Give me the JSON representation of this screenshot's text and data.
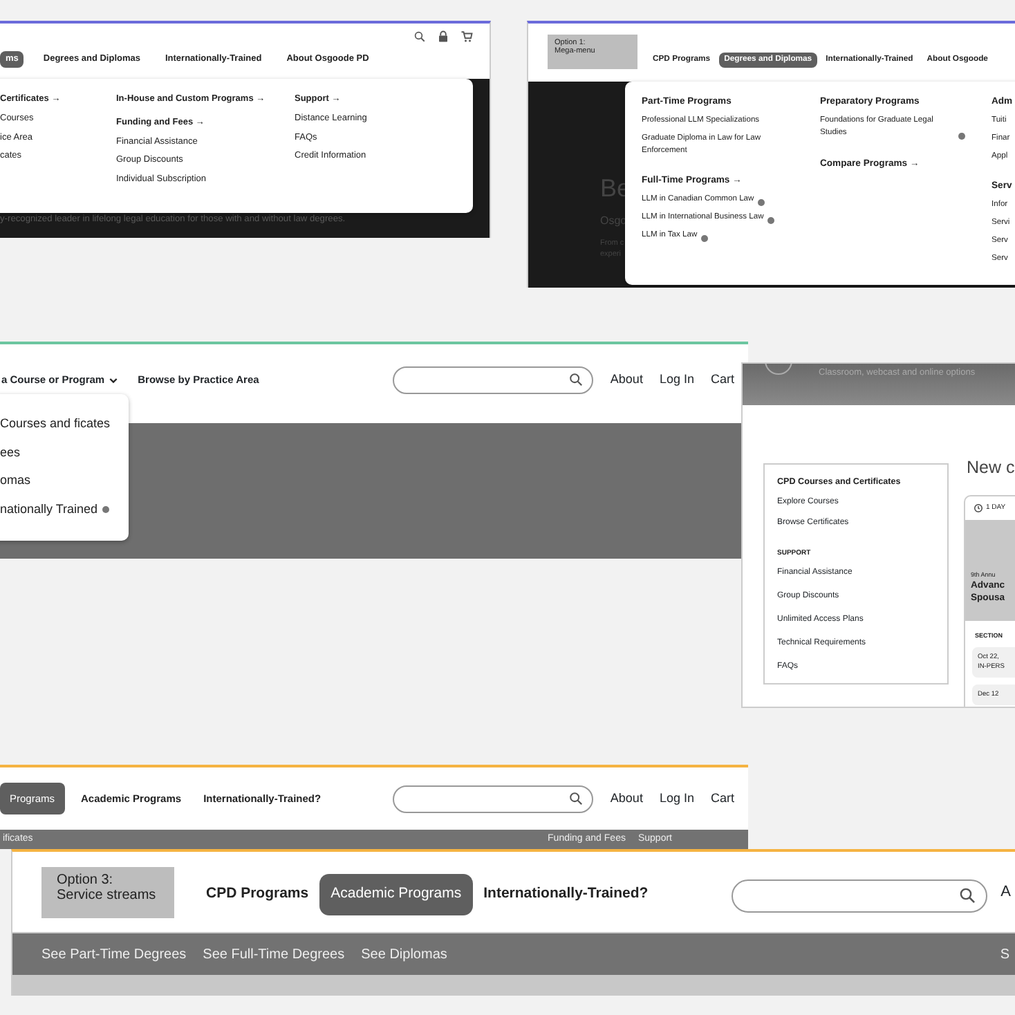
{
  "option_header_icons": {
    "nav": [
      {
        "label": "ms",
        "selected": true
      },
      {
        "label": "Degrees and Diplomas",
        "selected": false
      },
      {
        "label": "Internationally-Trained",
        "selected": false
      },
      {
        "label": "About Osgoode PD",
        "selected": false
      }
    ],
    "dropdown_columns": [
      [
        {
          "text": "Certificates →",
          "heading": true
        },
        {
          "text": "Courses",
          "heading": false
        },
        {
          "text": "ice Area",
          "heading": false
        },
        {
          "text": "cates",
          "heading": false
        }
      ],
      [
        {
          "text": "In-House and Custom Programs →",
          "heading": true
        },
        {
          "text": "Funding and Fees →",
          "heading": true
        },
        {
          "text": "Financial Assistance",
          "heading": false
        },
        {
          "text": "Group Discounts",
          "heading": false
        },
        {
          "text": "Individual Subscription",
          "heading": false
        }
      ],
      [
        {
          "text": "Support →",
          "heading": true
        },
        {
          "text": "Distance Learning",
          "heading": false
        },
        {
          "text": "FAQs",
          "heading": false
        },
        {
          "text": "Credit Information",
          "heading": false
        }
      ]
    ],
    "hero_text": "y-recognized leader in lifelong legal education for those with and without law degrees."
  },
  "option_1": {
    "label": "Option 1:\nMega-menu",
    "nav": [
      {
        "label": "CPD Programs",
        "selected": false
      },
      {
        "label": "Degrees and Diplomas",
        "selected": true
      },
      {
        "label": "Internationally-Trained",
        "selected": false
      },
      {
        "label": "About Osgoode",
        "selected": false
      }
    ],
    "hero": {
      "title": "Be",
      "subtitle": "Osgo",
      "body_lines": [
        "From c",
        "experi"
      ]
    },
    "mega_menu_columns": [
      [
        {
          "text": "Part-Time Programs",
          "heading": true,
          "info_icon": false
        },
        {
          "text": "Professional LLM Specializations",
          "heading": false,
          "info_icon": false
        },
        {
          "text": "Graduate Diploma in Law for Law Enforcement",
          "heading": false,
          "info_icon": false
        },
        {
          "text": "Full-Time Programs →",
          "heading": true,
          "info_icon": false
        },
        {
          "text": "LLM in Canadian Common Law",
          "heading": false,
          "info_icon": true
        },
        {
          "text": "LLM in International Business Law",
          "heading": false,
          "info_icon": true
        },
        {
          "text": "LLM in Tax Law",
          "heading": false,
          "info_icon": true
        }
      ],
      [
        {
          "text": "Preparatory Programs",
          "heading": true,
          "info_icon": false
        },
        {
          "text": "Foundations for Graduate Legal Studies",
          "heading": false,
          "info_icon": true
        },
        {
          "text": "Compare Programs →",
          "heading": true,
          "info_icon": false
        }
      ],
      [
        {
          "text": "Adm",
          "heading": true,
          "info_icon": false
        },
        {
          "text": "Tuiti",
          "heading": false,
          "info_icon": false
        },
        {
          "text": "Finar",
          "heading": false,
          "info_icon": false
        },
        {
          "text": "Appl",
          "heading": false,
          "info_icon": false
        },
        {
          "text": "Serv",
          "heading": true,
          "info_icon": false
        },
        {
          "text": "Infor",
          "heading": false,
          "info_icon": false
        },
        {
          "text": "Servi",
          "heading": false,
          "info_icon": false
        },
        {
          "text": "Serv",
          "heading": false,
          "info_icon": false
        },
        {
          "text": "Serv",
          "heading": false,
          "info_icon": false
        }
      ]
    ]
  },
  "option_dropdown": {
    "nav": [
      "a Course or Program",
      "Browse by Practice Area"
    ],
    "utility_links": [
      "About",
      "Log In",
      "Cart"
    ],
    "dropdown_items": [
      {
        "text": "Courses and ficates",
        "info_icon": false
      },
      {
        "text": "ees",
        "info_icon": false
      },
      {
        "text": "omas",
        "info_icon": false
      },
      {
        "text": "nationally Trained",
        "info_icon": true
      }
    ]
  },
  "landing_page": {
    "banner_text": "Classroom, webcast and online options",
    "heading": "New c",
    "sidebar": {
      "title": "CPD Courses and Certificates",
      "links": [
        "Explore Courses",
        "Browse Certificates"
      ],
      "section_title": "SUPPORT",
      "support_links": [
        "Financial Assistance",
        "Group Discounts",
        "Unlimited Access Plans",
        "Technical Requirements",
        "FAQs"
      ]
    },
    "course_card": {
      "duration": "1 DAY",
      "eyebrow": "9th Annu",
      "title_lines": [
        "Advanc",
        "Spousa"
      ],
      "section_label": "SECTION",
      "sessions": [
        {
          "date": "Oct 22,",
          "format": "IN-PERS"
        },
        {
          "date": "Dec 12"
        }
      ]
    }
  },
  "option_streams_compact": {
    "nav": [
      {
        "label": "Programs",
        "selected": true
      },
      {
        "label": "Academic Programs",
        "selected": false
      },
      {
        "label": "Internationally-Trained?",
        "selected": false
      }
    ],
    "utility_links": [
      "About",
      "Log In",
      "Cart"
    ],
    "subnav_left": [
      "ificates"
    ],
    "subnav_right": [
      "Funding and Fees",
      "Support"
    ]
  },
  "option_3": {
    "label": "Option 3:\nService streams",
    "nav": [
      {
        "label": "CPD Programs",
        "selected": false
      },
      {
        "label": "Academic Programs",
        "selected": true
      },
      {
        "label": "Internationally-Trained?",
        "selected": false
      }
    ],
    "utility_links": [
      "A"
    ],
    "subnav_left": [
      "See Part-Time Degrees",
      "See Full-Time Degrees",
      "See Diplomas"
    ],
    "subnav_right": [
      "S"
    ]
  }
}
